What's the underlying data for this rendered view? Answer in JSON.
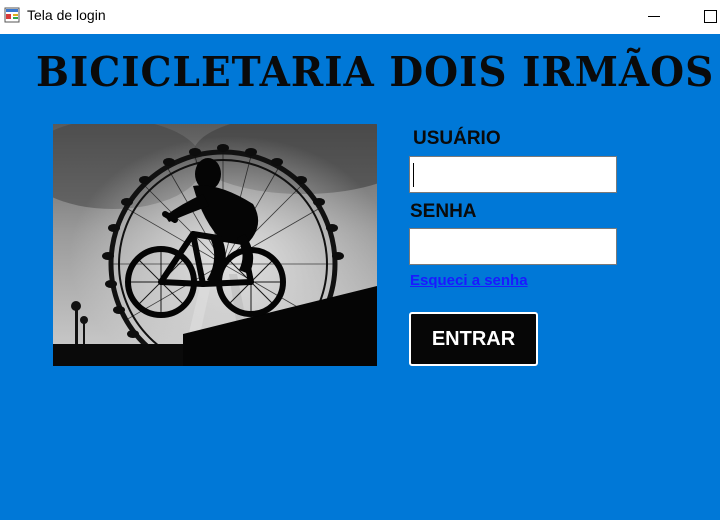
{
  "window": {
    "title": "Tela de login",
    "icon": "windows-form-icon",
    "controls": [
      "minimize-icon",
      "maximize-icon"
    ]
  },
  "header": {
    "title": "BICICLETARIA DOIS IRMÃOS"
  },
  "hero_image": {
    "subject": "cyclist-silhouette-ferris-wheel"
  },
  "form": {
    "username_label": "USUÁRIO",
    "username_value": "",
    "password_label": "SENHA",
    "password_value": "",
    "forgot_link": "Esqueci a senha",
    "submit_label": "ENTRAR"
  },
  "colors": {
    "background": "#0078d7",
    "text": "#0a0a0a",
    "link": "#1a1aff",
    "button_bg": "#060606",
    "button_text": "#ffffff"
  }
}
